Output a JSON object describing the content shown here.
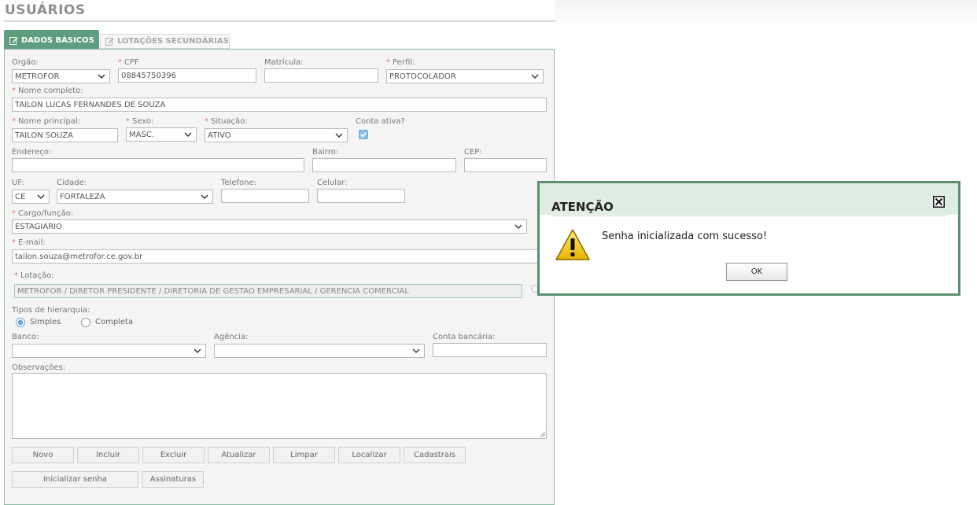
{
  "page": {
    "title": "USUÁRIOS"
  },
  "tabs": [
    {
      "label": "DADOS BÁSICOS",
      "active": true,
      "icon": "edit-icon"
    },
    {
      "label": "LOTAÇÕES SECUNDÁRIAS",
      "active": false,
      "icon": "edit-icon"
    }
  ],
  "form": {
    "orgao": {
      "label": "Orgão:",
      "value": "METROFOR"
    },
    "cpf": {
      "label": "CPF",
      "value": "08845750396"
    },
    "matricula": {
      "label": "Matrícula:",
      "value": ""
    },
    "perfil": {
      "label": "Perfil:",
      "value": "PROTOCOLADOR"
    },
    "nome_completo": {
      "label": "Nome completo:",
      "value": "TAILON LUCAS FERNANDES DE SOUZA"
    },
    "nome_principal": {
      "label": "Nome principal:",
      "value": "TAILON SOUZA"
    },
    "sexo": {
      "label": "Sexo:",
      "value": "MASC."
    },
    "situacao": {
      "label": "Situação:",
      "value": "ATIVO"
    },
    "conta_ativa": {
      "label": "Conta ativa?",
      "checked": true
    },
    "endereco": {
      "label": "Endereço:",
      "value": ""
    },
    "bairro": {
      "label": "Bairro:",
      "value": ""
    },
    "cep": {
      "label": "CEP:",
      "value": ""
    },
    "uf": {
      "label": "UF:",
      "value": "CE"
    },
    "cidade": {
      "label": "Cidade:",
      "value": "FORTALEZA"
    },
    "telefone": {
      "label": "Telefone:",
      "value": ""
    },
    "celular": {
      "label": "Celular:",
      "value": ""
    },
    "cargo": {
      "label": "Cargo/função:",
      "value": "ESTAGIARIO"
    },
    "email": {
      "label": "E-mail:",
      "value": "tailon.souza@metrofor.ce.gov.br"
    },
    "lotacao": {
      "label": "Lotação:",
      "value": "METROFOR / DIRETOR PRESIDENTE / DIRETORIA DE GESTAO EMPRESARIAL / GERENCIA COMERCIAL"
    },
    "hierarquia": {
      "label": "Tipos de hierarquia:",
      "options": [
        "Simples",
        "Completa"
      ],
      "selected": "Simples"
    },
    "banco": {
      "label": "Banco:",
      "value": ""
    },
    "agencia": {
      "label": "Agência:",
      "value": ""
    },
    "conta_bancaria": {
      "label": "Conta bancária:",
      "value": ""
    },
    "observacoes": {
      "label": "Observações:",
      "value": ""
    }
  },
  "buttons": {
    "row1": [
      "Novo",
      "Incluir",
      "Excluir",
      "Atualizar",
      "Limpar",
      "Localizar",
      "Cadastrais"
    ],
    "row2": [
      "Inicializar senha",
      "Assinaturas"
    ]
  },
  "dialog": {
    "title": "ATENÇÃO",
    "message": "Senha inicializada com sucesso!",
    "ok_label": "OK",
    "icon": "warning-icon",
    "close_icon": "close-icon"
  },
  "colors": {
    "accent": "#5e9d7e",
    "dialog_border": "#5a8f6f",
    "required": "#e07a5f"
  }
}
